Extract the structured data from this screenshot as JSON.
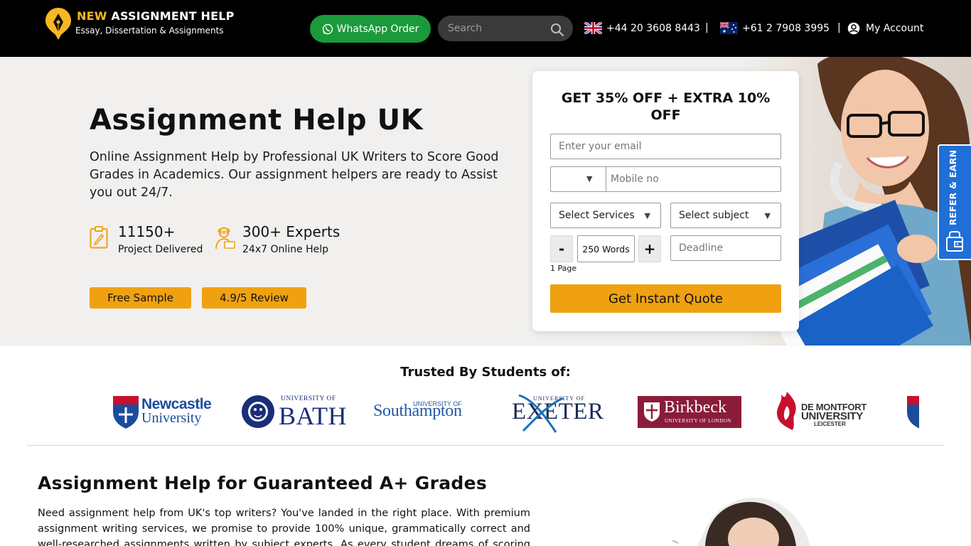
{
  "header": {
    "logo_brand_highlight": "NEW",
    "logo_brand_rest": "ASSIGNMENT HELP",
    "logo_tagline": "Essay, Dissertation & Assignments",
    "whatsapp_label": "WhatsApp Order",
    "search_placeholder": "Search",
    "phone_uk": "+44 20 3608 8443",
    "phone_au": "+61 2 7908 3995",
    "separator": "|",
    "account_label": "My Account"
  },
  "hero": {
    "title": "Assignment Help UK",
    "description": "Online Assignment Help by Professional UK Writers to Score Good Grades in Academics. Our assignment helpers are ready to Assist you out 24/7.",
    "stats": [
      {
        "number": "11150+",
        "label": "Project Delivered",
        "icon": "clipboard-icon"
      },
      {
        "number": "300+ Experts",
        "label": "24x7 Online Help",
        "icon": "expert-icon"
      }
    ],
    "free_sample_label": "Free Sample",
    "review_label": "4.9/5 Review"
  },
  "quote_form": {
    "title": "GET 35% OFF + EXTRA 10% OFF",
    "email_placeholder": "Enter your email",
    "country_code_value": "",
    "mobile_placeholder": "Mobile no",
    "services_label": "Select Services",
    "subject_label": "Select subject",
    "minus_label": "-",
    "words_value": "250 Words",
    "plus_label": "+",
    "pages_label": "1 Page",
    "deadline_placeholder": "Deadline",
    "submit_label": "Get Instant Quote"
  },
  "refer": {
    "label": "REFER & EARN"
  },
  "trusted": {
    "title": "Trusted By Students of:",
    "logos": [
      {
        "name": "Newcastle University",
        "line1": "Newcastle",
        "line2": "University"
      },
      {
        "name": "University of Bath",
        "line1": "UNIVERSITY OF",
        "line2": "BATH"
      },
      {
        "name": "University of Southampton",
        "line1": "UNIVERSITY OF",
        "line2": "Southampton"
      },
      {
        "name": "University of Exeter",
        "line1": "UNIVERSITY OF",
        "line2": "EXETER"
      },
      {
        "name": "Birkbeck University of London",
        "line1": "Birkbeck",
        "line2": "UNIVERSITY OF LONDON"
      },
      {
        "name": "De Montfort University Leicester",
        "line1": "DE MONTFORT",
        "line2": "UNIVERSITY",
        "line3": "LEICESTER"
      }
    ]
  },
  "article": {
    "title": "Assignment Help for Guaranteed A+ Grades",
    "text": "Need assignment help from UK's top writers? You've landed in the right place. With premium assignment writing services, we promise to provide 100% unique, grammatically correct and well-researched assignments written by subject experts. As every student dreams of scoring high"
  },
  "colors": {
    "accent": "#f0a112",
    "header_bg": "#000000",
    "whatsapp": "#1a9a3a",
    "refer_bg": "#1f6fd6",
    "hero_bg": "#f1f0ee"
  }
}
